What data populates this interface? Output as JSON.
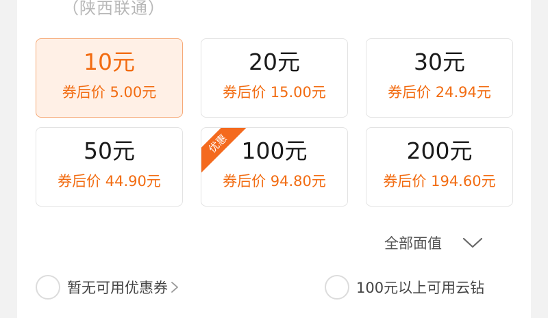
{
  "header": {
    "carrier": "（陕西联通）"
  },
  "cards": [
    {
      "face": "10元",
      "after_price": "券后价 5.00元",
      "selected": true,
      "badge": ""
    },
    {
      "face": "20元",
      "after_price": "券后价 15.00元",
      "selected": false,
      "badge": ""
    },
    {
      "face": "30元",
      "after_price": "券后价 24.94元",
      "selected": false,
      "badge": ""
    },
    {
      "face": "50元",
      "after_price": "券后价 44.90元",
      "selected": false,
      "badge": ""
    },
    {
      "face": "100元",
      "after_price": "券后价 94.80元",
      "selected": false,
      "badge": "优惠"
    },
    {
      "face": "200元",
      "after_price": "券后价 194.60元",
      "selected": false,
      "badge": ""
    }
  ],
  "filter": {
    "all_values_label": "全部面值",
    "icon": "chevron-down-icon"
  },
  "options": {
    "coupon_label": "暂无可用优惠券",
    "coin_label": "100元以上可用云钻"
  },
  "colors": {
    "accent": "#f26c12",
    "selected_bg": "#fff0e6",
    "selected_border": "#f6aa78",
    "badge_bg": "#f46a1e"
  }
}
